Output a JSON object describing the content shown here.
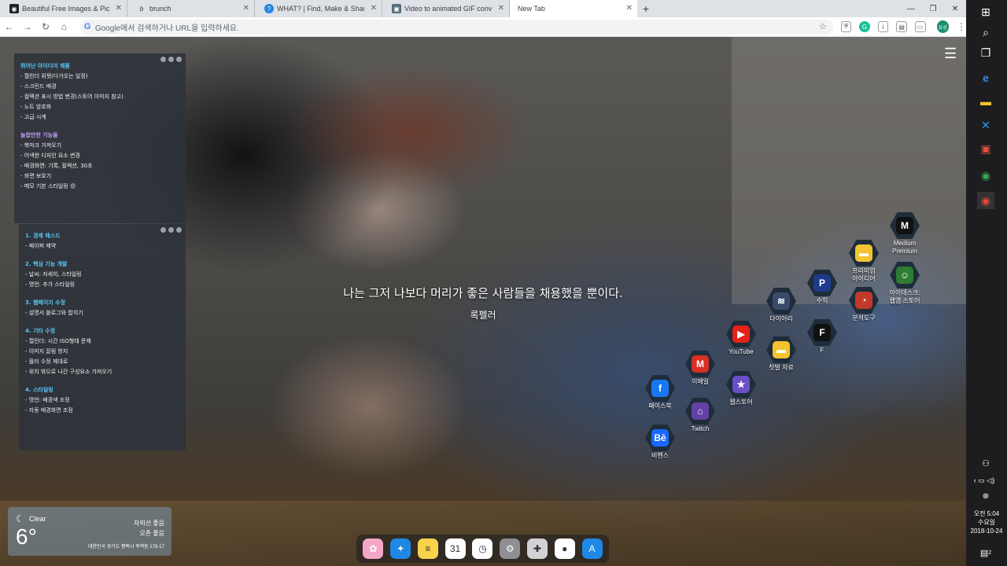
{
  "browser": {
    "tabs": [
      {
        "label": "Beautiful Free Images & Pictures",
        "icon": "camera-icon",
        "active": false
      },
      {
        "label": "brunch",
        "icon": "brunch-icon",
        "active": false
      },
      {
        "label": "WHAT? | Find, Make & Share G",
        "icon": "giphy-icon",
        "active": false
      },
      {
        "label": "Video to animated GIF converte",
        "icon": "gif-icon",
        "active": false
      },
      {
        "label": "New Tab",
        "icon": "",
        "active": true
      }
    ],
    "new_tab_symbol": "+",
    "omnibox_placeholder": "Google에서 검색하거나 URL을 입력하세요.",
    "profile_initials": "유성"
  },
  "notes": {
    "panel1": {
      "sections": [
        {
          "title": "뛰어난 아이디어 제품",
          "title_color": "#56c8f5",
          "items": [
            "- 캘린더 위젯(다가오는 일정)",
            "- 스크린드 배경",
            "- 컬렉션 표시 방법 변경(스토어 이미지 참고)",
            "- 노트 암호화",
            "- 고급 시계"
          ]
        },
        {
          "title": "놀랍만한 기능들",
          "title_color": "#c59bf5",
          "items": [
            "- 북마크 가져오기",
            "- 어색한 디자인 요소 변경",
            "- 배경화면: 기록, 컬렉션, 30초",
            "- 화면 보호기",
            "- 메모 기본 스타일링 😍"
          ]
        }
      ]
    },
    "panel2": {
      "sections": [
        {
          "title": "1. 경제 헤스드",
          "title_color": "#56c8f5",
          "items": [
            "- 페이퍼 제약"
          ]
        },
        {
          "title": "2. 핵심 기능 개발",
          "title_color": "#56c8f5",
          "items": [
            "- 날씨: 자세히, 스타일링",
            "- 명언: 추가 스타일링"
          ]
        },
        {
          "title": "3. 웹페이지 수정",
          "title_color": "#56c8f5",
          "items": [
            "- 설명서 블로그와 합치기"
          ]
        },
        {
          "title": "4. 기타 수정",
          "title_color": "#56c8f5",
          "items": [
            "- 캘린더: 시간 ISO형태 문제",
            "- 이미지 끌림 방지",
            "- 플러 수정 제대로",
            "- 위치 밖으로 나간 구성요소 가져오기"
          ]
        },
        {
          "title": "4. 스타일링",
          "title_color": "#56c8f5",
          "items": [
            "- 명언: 배경색 조정",
            "- 자동 배경화면 조정"
          ]
        }
      ]
    }
  },
  "quote": {
    "text": "나는 그저 나보다 머리가 좋은 사람들을 채용했을 뿐이다.",
    "author": "록펠러"
  },
  "shortcuts": [
    {
      "label": "Medium\nPremium",
      "icon": "medium-icon",
      "glyph": "M",
      "color": "#111111"
    },
    {
      "label": "프리미엄\n아이디어",
      "icon": "folder-icon",
      "glyph": "▬",
      "color": "#f4c430"
    },
    {
      "label": "아이데스크:\n웹앱 스토어",
      "icon": "mascot-icon",
      "glyph": "☺",
      "color": "#2e7d32"
    },
    {
      "label": "수익",
      "icon": "paypal-icon",
      "glyph": "P",
      "color": "#1e3a8a"
    },
    {
      "label": "분석도구",
      "icon": "analytics-icon",
      "glyph": "◔",
      "color": "#c0392b"
    },
    {
      "label": "다이어리",
      "icon": "layers-icon",
      "glyph": "≋",
      "color": "#3a4a6a"
    },
    {
      "label": "F",
      "icon": "font-icon",
      "glyph": "F",
      "color": "#111111"
    },
    {
      "label": "YouTube",
      "icon": "youtube-icon",
      "glyph": "▶",
      "color": "#e62117"
    },
    {
      "label": "첫발 자료",
      "icon": "folder-open-icon",
      "glyph": "▬",
      "color": "#f4c430"
    },
    {
      "label": "이메일",
      "icon": "gmail-icon",
      "glyph": "M",
      "color": "#d93025"
    },
    {
      "label": "웹스토어",
      "icon": "star-icon",
      "glyph": "★",
      "color": "#6a4fc7"
    },
    {
      "label": "페이스북",
      "icon": "facebook-icon",
      "glyph": "f",
      "color": "#1877f2"
    },
    {
      "label": "Twitch",
      "icon": "twitch-icon",
      "glyph": "⌂",
      "color": "#6441a5"
    },
    {
      "label": "비헨스",
      "icon": "behance-icon",
      "glyph": "Bē",
      "color": "#1769ff"
    }
  ],
  "weather": {
    "condition": "Clear",
    "temperature": "6°",
    "uv": "자외선 좋음",
    "ozone": "오존 좋음",
    "location": "대한민국 경기도 평택시 죽백동 178-17"
  },
  "dock": [
    {
      "icon": "photos-icon",
      "glyph": "✿",
      "color": "#f3a6c8"
    },
    {
      "icon": "safari-icon",
      "glyph": "✦",
      "color": "#1e88e5"
    },
    {
      "icon": "notes-icon",
      "glyph": "≡",
      "color": "#f7d34b"
    },
    {
      "icon": "calendar-icon",
      "glyph": "31",
      "color": "#ffffff"
    },
    {
      "icon": "clock-icon",
      "glyph": "◷",
      "color": "#ffffff"
    },
    {
      "icon": "settings-icon",
      "glyph": "⚙",
      "color": "#8e8e93"
    },
    {
      "icon": "extensions-icon",
      "glyph": "✚",
      "color": "#d1d1d6"
    },
    {
      "icon": "reminders-icon",
      "glyph": "●",
      "color": "#ffffff"
    },
    {
      "icon": "appstore-icon",
      "glyph": "A",
      "color": "#1e88e5"
    }
  ],
  "taskbar": {
    "time": "오전 5:04",
    "weekday": "수요일",
    "date": "2018-10-24",
    "notification_count": "2"
  }
}
